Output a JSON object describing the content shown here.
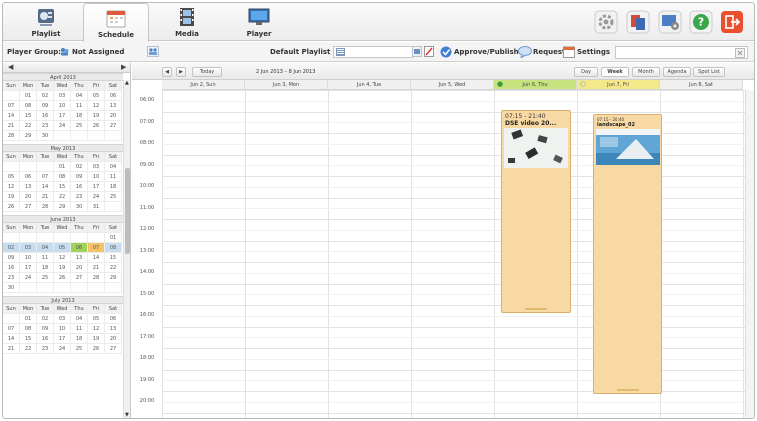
{
  "nav": {
    "tabs": [
      {
        "label": "Playlist"
      },
      {
        "label": "Schedule"
      },
      {
        "label": "Media"
      },
      {
        "label": "Player"
      }
    ]
  },
  "toolbar": {
    "player_group_label": "Player Group:",
    "player_group_value": "Not Assigned",
    "default_playlist_label": "Default Playlist :",
    "approve_label": "Approve/Publish",
    "request_label": "Request",
    "settings_label": "Settings"
  },
  "minical": {
    "day_headers": [
      "Sun",
      "Mon",
      "Tue",
      "Wed",
      "Thu",
      "Fri",
      "Sat"
    ],
    "months": [
      {
        "title": "April 2013",
        "weeks": [
          [
            "",
            "01",
            "02",
            "03",
            "04",
            "05",
            "06"
          ],
          [
            "07",
            "08",
            "09",
            "10",
            "11",
            "12",
            "13"
          ],
          [
            "14",
            "15",
            "16",
            "17",
            "18",
            "19",
            "20"
          ],
          [
            "21",
            "22",
            "23",
            "24",
            "25",
            "26",
            "27"
          ],
          [
            "28",
            "29",
            "30",
            "",
            "",
            "",
            ""
          ]
        ]
      },
      {
        "title": "May 2013",
        "weeks": [
          [
            "",
            "",
            "",
            "01",
            "02",
            "03",
            "04"
          ],
          [
            "05",
            "06",
            "07",
            "08",
            "09",
            "10",
            "11"
          ],
          [
            "12",
            "13",
            "14",
            "15",
            "16",
            "17",
            "18"
          ],
          [
            "19",
            "20",
            "21",
            "22",
            "23",
            "24",
            "25"
          ],
          [
            "26",
            "27",
            "28",
            "29",
            "30",
            "31",
            ""
          ]
        ]
      },
      {
        "title": "June 2013",
        "weeks": [
          [
            "",
            "",
            "",
            "",
            "",
            "",
            "01"
          ],
          [
            "02",
            "03",
            "04",
            "05",
            "06",
            "07",
            "08"
          ],
          [
            "09",
            "10",
            "11",
            "12",
            "13",
            "14",
            "15"
          ],
          [
            "16",
            "17",
            "18",
            "19",
            "20",
            "21",
            "22"
          ],
          [
            "23",
            "24",
            "25",
            "26",
            "27",
            "28",
            "29"
          ],
          [
            "30",
            "",
            "",
            "",
            "",
            "",
            ""
          ]
        ]
      },
      {
        "title": "July 2013",
        "weeks": [
          [
            "",
            "01",
            "02",
            "03",
            "04",
            "05",
            "06"
          ],
          [
            "07",
            "08",
            "09",
            "10",
            "11",
            "12",
            "13"
          ],
          [
            "14",
            "15",
            "16",
            "17",
            "18",
            "19",
            "20"
          ],
          [
            "21",
            "22",
            "23",
            "24",
            "25",
            "26",
            "27"
          ]
        ]
      }
    ]
  },
  "calendar": {
    "today_label": "Today",
    "range_label": "2 Jun 2013 – 8 Jun 2013",
    "view_buttons": [
      "Day",
      "Week",
      "Month",
      "Agenda",
      "Spot List"
    ],
    "active_view": "Week",
    "days": [
      "Jun 2, Sun",
      "Jun 3, Mon",
      "Jun 4, Tue",
      "Jun 5, Wed",
      "Jun 6, Thu",
      "Jun 7, Fri",
      "Jun 8, Sat"
    ],
    "hours": [
      "06:00",
      "07:00",
      "08:00",
      "09:00",
      "10:00",
      "11:00",
      "12:00",
      "13:00",
      "14:00",
      "15:00",
      "16:00",
      "17:00",
      "18:00",
      "19:00",
      "20:00",
      "21:00"
    ],
    "events": [
      {
        "time": "07:15 - 21:40",
        "title": "DSE video 20..."
      },
      {
        "time": "07:15 - 20:40",
        "title": "landscape_02"
      }
    ]
  }
}
